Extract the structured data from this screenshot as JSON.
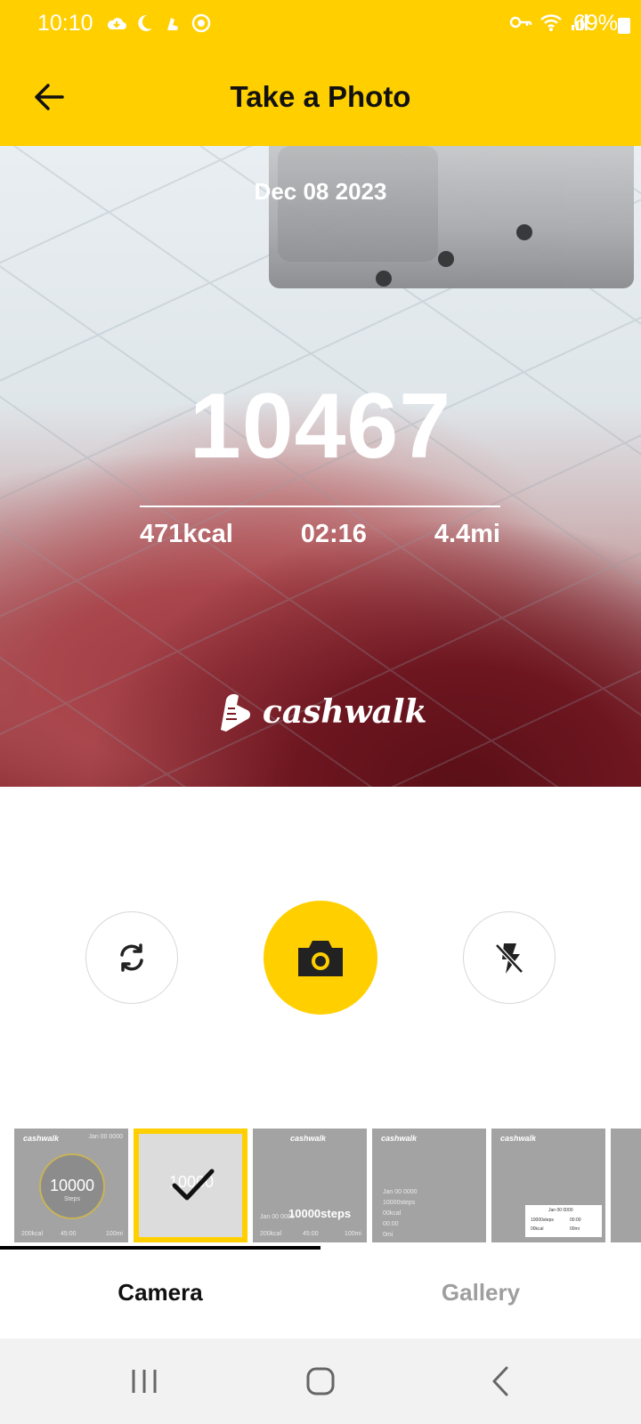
{
  "status_bar": {
    "time": "10:10",
    "battery": "69%",
    "left_icons": [
      "cloud-icon",
      "moon-icon",
      "cashwalk-notification-icon",
      "circle-notification-icon"
    ],
    "right_icons": [
      "vpn-key-icon",
      "wifi-icon",
      "signal-icon",
      "battery-icon"
    ]
  },
  "header": {
    "title": "Take a Photo",
    "back_icon": "arrow-left-icon"
  },
  "preview": {
    "date": "Dec 08 2023",
    "steps": "10467",
    "calories": "471kcal",
    "duration": "02:16",
    "distance": "4.4mi",
    "brand": "cashwalk"
  },
  "controls": {
    "switch_icon": "camera-switch-icon",
    "shutter_icon": "camera-icon",
    "flash_icon": "flash-off-icon"
  },
  "templates": [
    {
      "logo": "cashwalk",
      "date": "Jan 00 0000",
      "steps": "10000",
      "label": "Steps",
      "cal": "200kcal",
      "time": "45:00",
      "dist": "100mi"
    },
    {
      "logo": "",
      "date": "",
      "steps": "10000",
      "selected": true
    },
    {
      "logo": "cashwalk",
      "date": "Jan 00 0000",
      "steps": "10000steps",
      "cal": "200kcal",
      "time": "45:00",
      "dist": "100mi"
    },
    {
      "logo": "cashwalk",
      "date": "Jan 00 0000",
      "lines": [
        "10000steps",
        "00kcal",
        "00:00",
        "0mi"
      ]
    },
    {
      "logo": "cashwalk",
      "card_date": "Jan 00 0000",
      "card_lines": [
        "10000steps",
        "00:00",
        "00kcal",
        "00mi"
      ]
    }
  ],
  "tabs": {
    "camera": "Camera",
    "gallery": "Gallery",
    "active": "camera"
  },
  "nav": {
    "recents": "recents-icon",
    "home": "home-icon",
    "back": "back-icon"
  },
  "colors": {
    "accent": "#FFCF00",
    "tab_inactive": "#9e9e9e",
    "template_bg": "#a3a3a3"
  }
}
